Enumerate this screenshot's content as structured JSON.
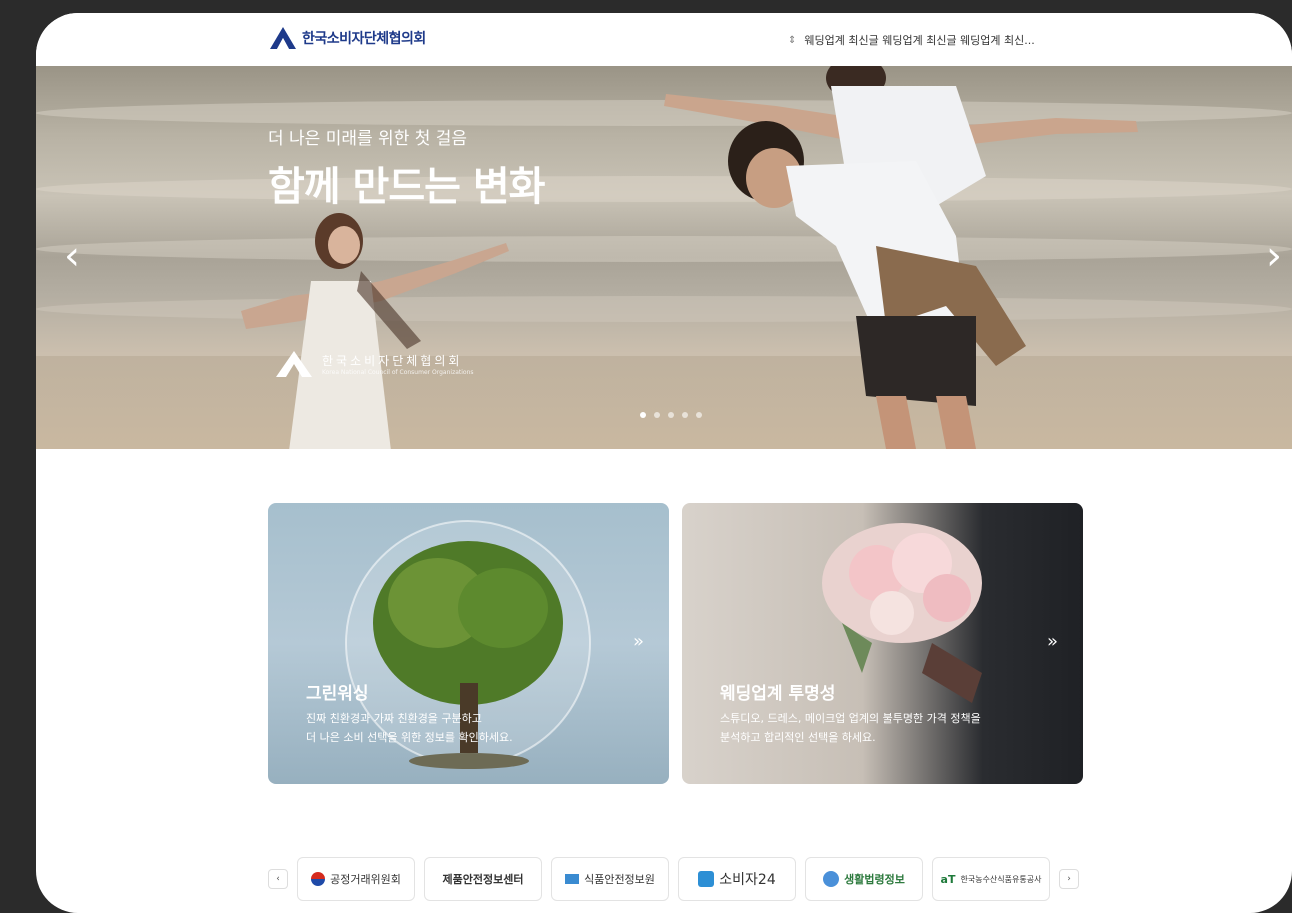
{
  "header": {
    "logo_text": "한국소비자단체협의회",
    "ticker_text": "웨딩업계 최신글 웨딩업계 최신글 웨딩업계 최신..."
  },
  "hero": {
    "subtitle": "더 나은 미래를 위한 첫 걸음",
    "title": "함께 만드는 변화",
    "prev_arrow": "‹",
    "next_arrow": "›",
    "logo_name": "한국소비자단체협의회",
    "logo_en": "Korea National Council of Consumer Organizations",
    "slide_count": 5,
    "active_slide": 1
  },
  "cards": [
    {
      "title": "그린워싱",
      "desc_lines": [
        "진짜 친환경과 가짜 친환경을 구분하고",
        "더 나은 소비 선택을 위한 정보를 확인하세요."
      ],
      "chevron": "»"
    },
    {
      "title": "웨딩업계 투명성",
      "desc_lines": [
        "스튜디오, 드레스, 메이크업 업계의 불투명한 가격 정책을",
        "분석하고 합리적인 선택을 하세요."
      ],
      "chevron": "»"
    }
  ],
  "partners": {
    "prev": "‹",
    "next": "›",
    "items": [
      {
        "label": "공정거래위원회"
      },
      {
        "label": "제품안전정보센터"
      },
      {
        "label": "식품안전정보원"
      },
      {
        "label": "소비자24"
      },
      {
        "label": "생활법령정보"
      },
      {
        "label": "한국농수산식품유통공사"
      }
    ]
  },
  "colors": {
    "brand": "#1e3a8a",
    "background": "#2b2b2b"
  }
}
